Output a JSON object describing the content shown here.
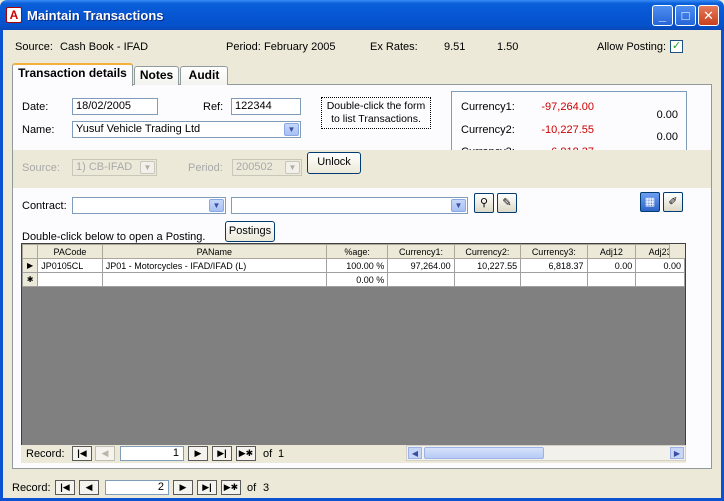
{
  "window": {
    "title": "Maintain Transactions",
    "app_icon": "A"
  },
  "header": {
    "source_label": "Source:",
    "source_value": "Cash Book - IFAD",
    "period_label": "Period:",
    "period_value": "February 2005",
    "exrates_label": "Ex Rates:",
    "exrate1": "9.51",
    "exrate2": "1.50",
    "allow_posting_label": "Allow Posting:",
    "allow_posting_checked": true
  },
  "tabs": [
    "Transaction details",
    "Notes",
    "Audit"
  ],
  "form": {
    "date_label": "Date:",
    "date_value": "18/02/2005",
    "ref_label": "Ref:",
    "ref_value": "122344",
    "name_label": "Name:",
    "name_value": "Yusuf Vehicle Trading Ltd",
    "hint": "Double-click the form to list Transactions.",
    "source_label": "Source:",
    "source_value": "1) CB-IFAD",
    "period_label": "Period:",
    "period_value": "200502",
    "unlock_label": "Unlock",
    "contract_label": "Contract:",
    "contract_value": "",
    "contract2_value": "",
    "posting_hint": "Double-click below to open a Posting.",
    "postings_label": "Postings"
  },
  "currency": {
    "rows": [
      {
        "label": "Currency1:",
        "value": "-97,264.00",
        "extra": "0.00"
      },
      {
        "label": "Currency2:",
        "value": "-10,227.55",
        "extra": "0.00"
      },
      {
        "label": "Currency3:",
        "value": "-6,818.37",
        "extra": ""
      }
    ],
    "negative_color": "#cc0000"
  },
  "grid": {
    "columns": [
      "PACode",
      "PAName",
      "%age:",
      "Currency1:",
      "Currency2:",
      "Currency3:",
      "Adj12",
      "Adj23"
    ],
    "rows": [
      [
        "JP0105CL",
        "JP01 - Motorcycles - IFAD/IFAD (L)",
        "100.00 %",
        "97,264.00",
        "10,227.55",
        "6,818.37",
        "0.00",
        "0.00"
      ]
    ],
    "new_row": [
      "",
      "",
      "0.00 %",
      "",
      "",
      "",
      "",
      ""
    ],
    "record_label": "Record:",
    "record_current": "1",
    "record_of": "of",
    "record_total": "1"
  },
  "main_nav": {
    "record_label": "Record:",
    "record_current": "2",
    "record_of": "of",
    "record_total": "3"
  }
}
